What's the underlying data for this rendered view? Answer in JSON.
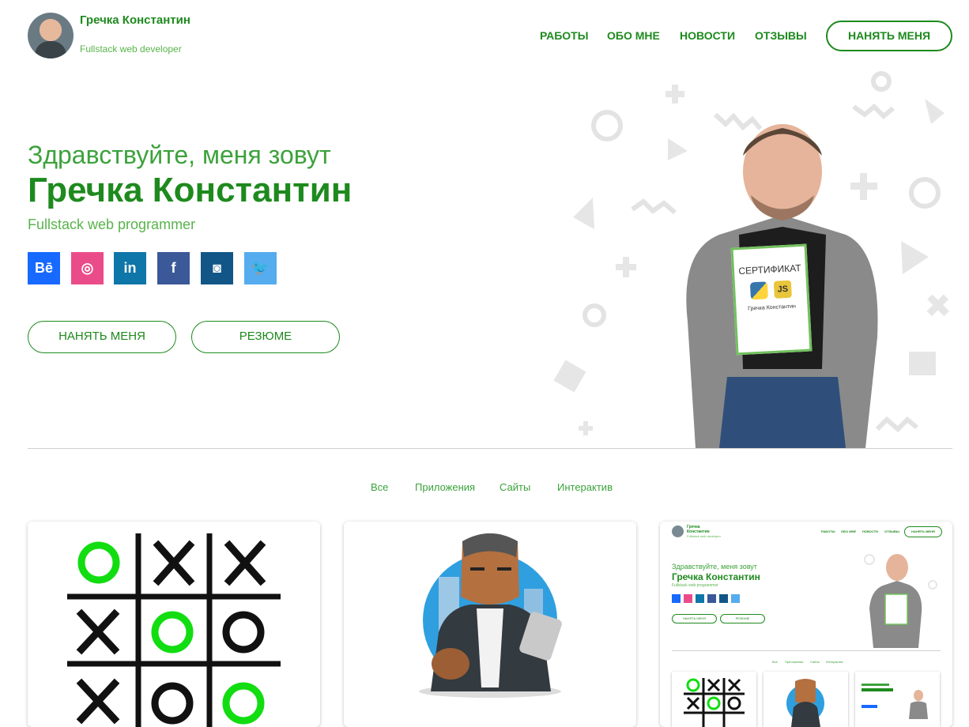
{
  "header": {
    "brand_name": "Гречка Константин",
    "brand_role": "Fullstack web developer",
    "nav": [
      "РАБОТЫ",
      "ОБО МНЕ",
      "НОВОСТИ",
      "ОТЗЫВЫ"
    ],
    "hire_button": "НАНЯТЬ МЕНЯ"
  },
  "hero": {
    "greeting": "Здравствуйте, меня зовут",
    "name": "Гречка Константин",
    "role": "Fullstack web programmer",
    "social": [
      {
        "name": "behance-icon",
        "glyph": "Bē",
        "color": "#1769ff"
      },
      {
        "name": "dribbble-icon",
        "glyph": "◎",
        "color": "#ea4c89"
      },
      {
        "name": "linkedin-icon",
        "glyph": "in",
        "color": "#0e76a8"
      },
      {
        "name": "facebook-icon",
        "glyph": "f",
        "color": "#3b5998"
      },
      {
        "name": "instagram-icon",
        "glyph": "◙",
        "color": "#125688"
      },
      {
        "name": "twitter-icon",
        "glyph": "🐦",
        "color": "#55acee"
      }
    ],
    "buttons": {
      "hire": "НАНЯТЬ МЕНЯ",
      "resume": "РЕЗЮМЕ"
    },
    "certificate": {
      "title": "СЕРТИФИКАТ",
      "name": "Гречка Константин"
    }
  },
  "portfolio": {
    "filters": [
      "Все",
      "Приложения",
      "Сайты",
      "Интерактив"
    ],
    "thumb": {
      "brand": "Гречка Константин",
      "role": "Fullstack web developer",
      "nav": [
        "РАБОТЫ",
        "ОБО МНЕ",
        "НОВОСТИ",
        "ОТЗЫВЫ"
      ],
      "hire": "НАНЯТЬ МЕНЯ",
      "greeting": "Здравствуйте, меня зовут",
      "name": "Гречка Константин",
      "prole": "Fullstack web programmer",
      "btn1": "НАНЯТЬ МЕНЯ",
      "btn2": "РЕЗЮМЕ",
      "filters": [
        "Все",
        "Приложения",
        "Сайты",
        "Интерактив"
      ]
    }
  },
  "colors": {
    "accent": "#1e8a1e",
    "accent_light": "#59b34c",
    "tictac_green": "#11dd11"
  }
}
